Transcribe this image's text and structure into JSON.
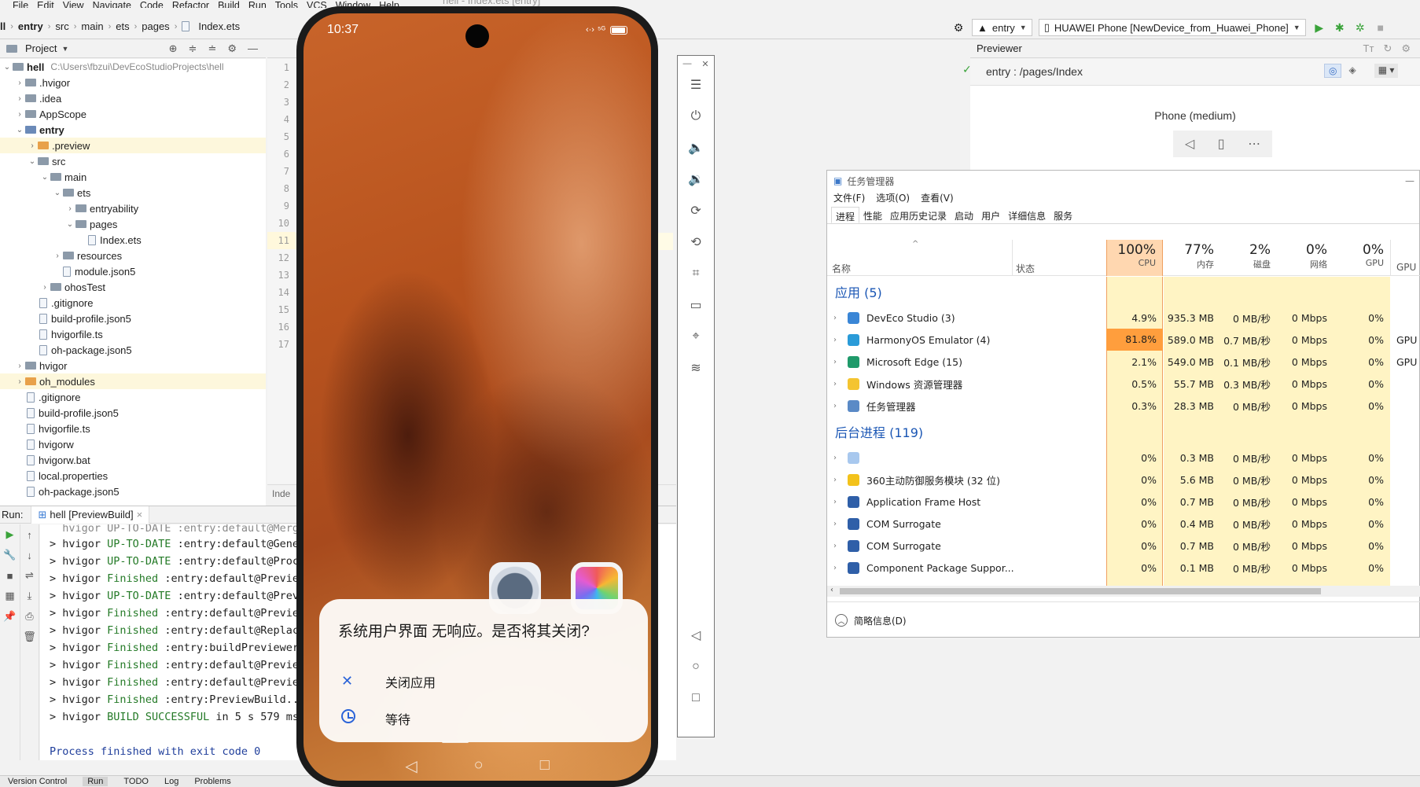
{
  "menu": {
    "items": [
      "File",
      "Edit",
      "View",
      "Navigate",
      "Code",
      "Refactor",
      "Build",
      "Run",
      "Tools",
      "VCS",
      "Window",
      "Help"
    ],
    "window_title": "hell - Index.ets [entry]"
  },
  "breadcrumb": [
    "ll",
    "entry",
    "src",
    "main",
    "ets",
    "pages",
    "Index.ets"
  ],
  "toolbar": {
    "module": "entry",
    "device": "HUAWEI Phone [NewDevice_from_Huawei_Phone]"
  },
  "project": {
    "title": "Project",
    "root_name": "hell",
    "root_path": "C:\\Users\\fbzui\\DevEcoStudioProjects\\hell",
    "items": [
      {
        "label": ".hvigor"
      },
      {
        "label": ".idea"
      },
      {
        "label": "AppScope"
      },
      {
        "label": "entry"
      },
      {
        "label": ".preview"
      },
      {
        "label": "src"
      },
      {
        "label": "main"
      },
      {
        "label": "ets"
      },
      {
        "label": "entryability"
      },
      {
        "label": "pages"
      },
      {
        "label": "Index.ets"
      },
      {
        "label": "resources"
      },
      {
        "label": "module.json5"
      },
      {
        "label": "ohosTest"
      },
      {
        "label": ".gitignore"
      },
      {
        "label": "build-profile.json5"
      },
      {
        "label": "hvigorfile.ts"
      },
      {
        "label": "oh-package.json5"
      },
      {
        "label": "hvigor"
      },
      {
        "label": "oh_modules"
      },
      {
        "label": ".gitignore"
      },
      {
        "label": "build-profile.json5"
      },
      {
        "label": "hvigorfile.ts"
      },
      {
        "label": "hvigorw"
      },
      {
        "label": "hvigorw.bat"
      },
      {
        "label": "local.properties"
      },
      {
        "label": "oh-package.json5"
      }
    ]
  },
  "editor": {
    "line_numbers": [
      "1",
      "2",
      "3",
      "4",
      "5",
      "6",
      "7",
      "8",
      "9",
      "10",
      "11",
      "12",
      "13",
      "14",
      "15",
      "16",
      "17"
    ],
    "footer": "Inde"
  },
  "run": {
    "label": "Run:",
    "tab": "hell [PreviewBuild]",
    "lines": [
      {
        "prefix": "> hvigor ",
        "status": "UP-TO-DATE",
        "task": " :entry:default@Gene"
      },
      {
        "prefix": "> hvigor ",
        "status": "UP-TO-DATE",
        "task": " :entry:default@Proc"
      },
      {
        "prefix": "> hvigor ",
        "status": "Finished",
        "task": " :entry:default@Previe"
      },
      {
        "prefix": "> hvigor ",
        "status": "UP-TO-DATE",
        "task": " :entry:default@Prev"
      },
      {
        "prefix": "> hvigor ",
        "status": "Finished",
        "task": " :entry:default@Previe"
      },
      {
        "prefix": "> hvigor ",
        "status": "Finished",
        "task": " :entry:default@Replac"
      },
      {
        "prefix": "> hvigor ",
        "status": "Finished",
        "task": " :entry:buildPreviewer"
      },
      {
        "prefix": "> hvigor ",
        "status": "Finished",
        "task": " :entry:default@Previe"
      },
      {
        "prefix": "> hvigor ",
        "status": "Finished",
        "task": " :entry:default@Previe"
      },
      {
        "prefix": "> hvigor ",
        "status": "Finished",
        "task": " :entry:PreviewBuild.."
      },
      {
        "prefix": "> hvigor ",
        "status": "BUILD SUCCESSFUL",
        "task": " in 5 s 579 ms"
      }
    ],
    "finish": "Process finished with exit code 0"
  },
  "bottom_tabs": [
    "Version Control",
    "Run",
    "TODO",
    "Log",
    "Problems"
  ],
  "phone": {
    "time": "10:37",
    "dialog_title": "系统用户界面 无响应。是否将其关闭?",
    "option_close": "关闭应用",
    "option_wait": "等待"
  },
  "previewer": {
    "title": "Previewer",
    "path": "entry : /pages/Index",
    "device": "Phone (medium)"
  },
  "taskmanager": {
    "title": "任务管理器",
    "menu": [
      "文件(F)",
      "选项(O)",
      "查看(V)"
    ],
    "tabs": [
      "进程",
      "性能",
      "应用历史记录",
      "启动",
      "用户",
      "详细信息",
      "服务"
    ],
    "col_name": "名称",
    "col_state": "状态",
    "metrics": [
      {
        "pct": "100%",
        "label": "CPU"
      },
      {
        "pct": "77%",
        "label": "内存"
      },
      {
        "pct": "2%",
        "label": "磁盘"
      },
      {
        "pct": "0%",
        "label": "网络"
      },
      {
        "pct": "0%",
        "label": "GPU"
      }
    ],
    "extra_col": "GPU",
    "group_apps": "应用 (5)",
    "group_bg": "后台进程 (119)",
    "apps": [
      {
        "name": "DevEco Studio (3)",
        "cpu": "4.9%",
        "mem": "935.3 MB",
        "disk": "0 MB/秒",
        "net": "0 Mbps",
        "gpu": "0%",
        "extra": ""
      },
      {
        "name": "HarmonyOS Emulator (4)",
        "cpu": "81.8%",
        "mem": "589.0 MB",
        "disk": "0.7 MB/秒",
        "net": "0 Mbps",
        "gpu": "0%",
        "extra": "GPU"
      },
      {
        "name": "Microsoft Edge (15)",
        "cpu": "2.1%",
        "mem": "549.0 MB",
        "disk": "0.1 MB/秒",
        "net": "0 Mbps",
        "gpu": "0%",
        "extra": "GPU"
      },
      {
        "name": "Windows 资源管理器",
        "cpu": "0.5%",
        "mem": "55.7 MB",
        "disk": "0.3 MB/秒",
        "net": "0 Mbps",
        "gpu": "0%",
        "extra": ""
      },
      {
        "name": "任务管理器",
        "cpu": "0.3%",
        "mem": "28.3 MB",
        "disk": "0 MB/秒",
        "net": "0 Mbps",
        "gpu": "0%",
        "extra": ""
      }
    ],
    "bg": [
      {
        "name": "",
        "cpu": "0%",
        "mem": "0.3 MB",
        "disk": "0 MB/秒",
        "net": "0 Mbps",
        "gpu": "0%"
      },
      {
        "name": "360主动防御服务模块 (32 位)",
        "cpu": "0%",
        "mem": "5.6 MB",
        "disk": "0 MB/秒",
        "net": "0 Mbps",
        "gpu": "0%"
      },
      {
        "name": "Application Frame Host",
        "cpu": "0%",
        "mem": "0.7 MB",
        "disk": "0 MB/秒",
        "net": "0 Mbps",
        "gpu": "0%"
      },
      {
        "name": "COM Surrogate",
        "cpu": "0%",
        "mem": "0.4 MB",
        "disk": "0 MB/秒",
        "net": "0 Mbps",
        "gpu": "0%"
      },
      {
        "name": "COM Surrogate",
        "cpu": "0%",
        "mem": "0.7 MB",
        "disk": "0 MB/秒",
        "net": "0 Mbps",
        "gpu": "0%"
      },
      {
        "name": "Component Package Suppor...",
        "cpu": "0%",
        "mem": "0.1 MB",
        "disk": "0 MB/秒",
        "net": "0 Mbps",
        "gpu": "0%"
      }
    ],
    "footer": "简略信息(D)"
  },
  "colors": {
    "cpu_header": "#ffd7b0",
    "cpu_light": "#fff4c4",
    "cpu_hot": "#ff9e3d",
    "group_text": "#1a56b4",
    "console_green": "#247a27",
    "console_blue": "#1f3e9b"
  }
}
